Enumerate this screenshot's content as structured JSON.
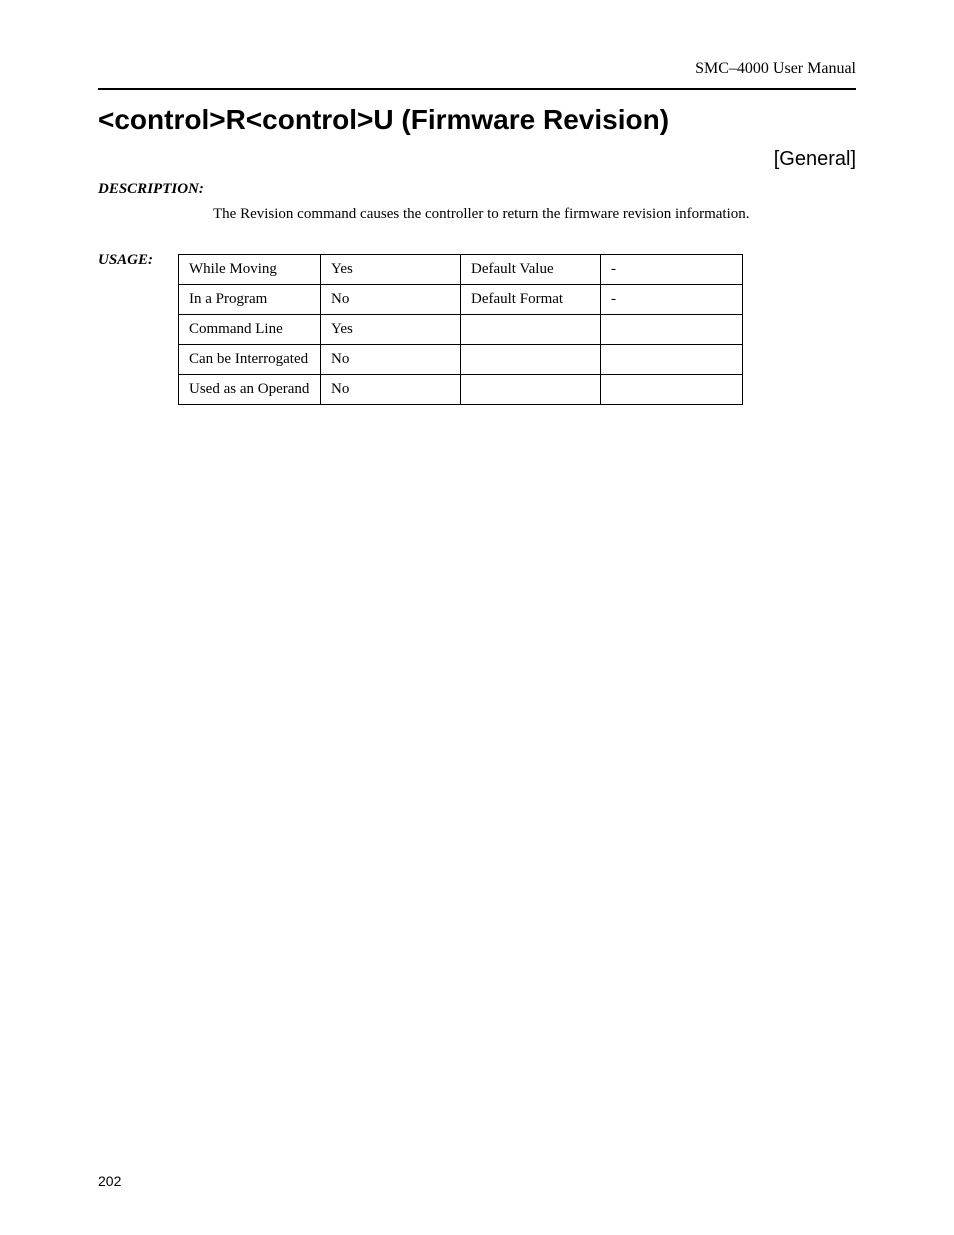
{
  "header": {
    "manual": "SMC–4000 User Manual"
  },
  "title": "<control>R<control>U (Firmware Revision)",
  "category": "[General]",
  "sections": {
    "description_label": "DESCRIPTION:",
    "description_text": "The Revision command causes the controller to return the firmware revision information.",
    "usage_label": "USAGE:"
  },
  "usage_table": {
    "rows": [
      {
        "p1": "While Moving",
        "p2": "Yes",
        "p3": "Default Value",
        "p4": "-"
      },
      {
        "p1": "In a Program",
        "p2": "No",
        "p3": "Default Format",
        "p4": "-"
      },
      {
        "p1": "Command Line",
        "p2": "Yes",
        "p3": "",
        "p4": ""
      },
      {
        "p1": "Can be Interrogated",
        "p2": "No",
        "p3": "",
        "p4": ""
      },
      {
        "p1": "Used as an Operand",
        "p2": "No",
        "p3": "",
        "p4": ""
      }
    ]
  },
  "page_number": "202"
}
